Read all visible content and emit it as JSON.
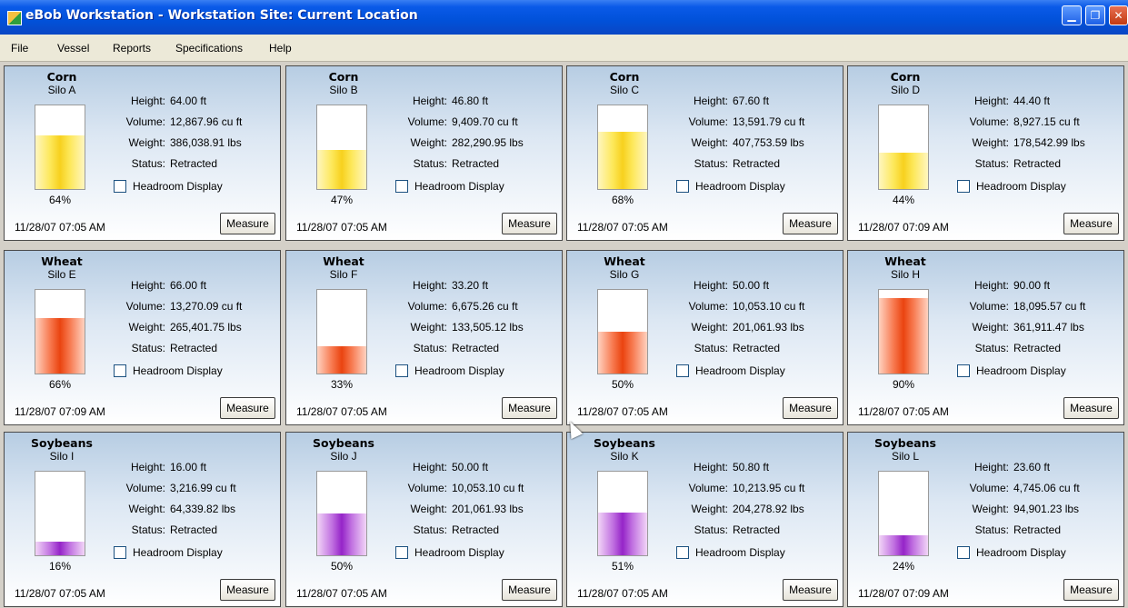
{
  "window": {
    "title": "eBob Workstation - Workstation Site: Current Location",
    "icons": [
      "app-icon",
      "minimize-icon",
      "restore-icon",
      "close-icon"
    ]
  },
  "menu": [
    "File",
    "Vessel",
    "Reports",
    "Specifications",
    "Help"
  ],
  "labels": {
    "height": "Height:",
    "volume": "Volume:",
    "weight": "Weight:",
    "status": "Status:",
    "headroom": "Headroom Display",
    "measure": "Measure"
  },
  "colors": {
    "corn": "#f7d11e",
    "wheat": "#ea4410",
    "soybeans": "#9524c8"
  },
  "silos": [
    {
      "crop": "Corn",
      "silo": "Silo A",
      "height": "64.00 ft",
      "volume": "12,867.96 cu ft",
      "weight": "386,038.91 lbs",
      "status": "Retracted",
      "percent": "64%",
      "fill": 0.64,
      "color": "yellow",
      "timestamp": "11/28/07 07:05 AM"
    },
    {
      "crop": "Corn",
      "silo": "Silo B",
      "height": "46.80 ft",
      "volume": "9,409.70 cu ft",
      "weight": "282,290.95 lbs",
      "status": "Retracted",
      "percent": "47%",
      "fill": 0.47,
      "color": "yellow",
      "timestamp": "11/28/07 07:05 AM"
    },
    {
      "crop": "Corn",
      "silo": "Silo C",
      "height": "67.60 ft",
      "volume": "13,591.79 cu ft",
      "weight": "407,753.59 lbs",
      "status": "Retracted",
      "percent": "68%",
      "fill": 0.68,
      "color": "yellow",
      "timestamp": "11/28/07 07:05 AM"
    },
    {
      "crop": "Corn",
      "silo": "Silo D",
      "height": "44.40 ft",
      "volume": "8,927.15 cu ft",
      "weight": "178,542.99 lbs",
      "status": "Retracted",
      "percent": "44%",
      "fill": 0.44,
      "color": "yellow",
      "timestamp": "11/28/07 07:09 AM"
    },
    {
      "crop": "Wheat",
      "silo": "Silo E",
      "height": "66.00 ft",
      "volume": "13,270.09 cu ft",
      "weight": "265,401.75 lbs",
      "status": "Retracted",
      "percent": "66%",
      "fill": 0.66,
      "color": "red",
      "timestamp": "11/28/07 07:09 AM"
    },
    {
      "crop": "Wheat",
      "silo": "Silo F",
      "height": "33.20 ft",
      "volume": "6,675.26 cu ft",
      "weight": "133,505.12 lbs",
      "status": "Retracted",
      "percent": "33%",
      "fill": 0.33,
      "color": "red",
      "timestamp": "11/28/07 07:05 AM"
    },
    {
      "crop": "Wheat",
      "silo": "Silo G",
      "height": "50.00 ft",
      "volume": "10,053.10 cu ft",
      "weight": "201,061.93 lbs",
      "status": "Retracted",
      "percent": "50%",
      "fill": 0.5,
      "color": "red",
      "timestamp": "11/28/07 07:05 AM"
    },
    {
      "crop": "Wheat",
      "silo": "Silo H",
      "height": "90.00 ft",
      "volume": "18,095.57 cu ft",
      "weight": "361,911.47 lbs",
      "status": "Retracted",
      "percent": "90%",
      "fill": 0.9,
      "color": "red",
      "timestamp": "11/28/07 07:05 AM"
    },
    {
      "crop": "Soybeans",
      "silo": "Silo I",
      "height": "16.00 ft",
      "volume": "3,216.99 cu ft",
      "weight": "64,339.82 lbs",
      "status": "Retracted",
      "percent": "16%",
      "fill": 0.16,
      "color": "purple",
      "timestamp": "11/28/07 07:05 AM"
    },
    {
      "crop": "Soybeans",
      "silo": "Silo J",
      "height": "50.00 ft",
      "volume": "10,053.10 cu ft",
      "weight": "201,061.93 lbs",
      "status": "Retracted",
      "percent": "50%",
      "fill": 0.5,
      "color": "purple",
      "timestamp": "11/28/07 07:05 AM"
    },
    {
      "crop": "Soybeans",
      "silo": "Silo K",
      "height": "50.80 ft",
      "volume": "10,213.95 cu ft",
      "weight": "204,278.92 lbs",
      "status": "Retracted",
      "percent": "51%",
      "fill": 0.51,
      "color": "purple",
      "timestamp": "11/28/07 07:05 AM"
    },
    {
      "crop": "Soybeans",
      "silo": "Silo L",
      "height": "23.60 ft",
      "volume": "4,745.06 cu ft",
      "weight": "94,901.23 lbs",
      "status": "Retracted",
      "percent": "24%",
      "fill": 0.24,
      "color": "purple",
      "timestamp": "11/28/07 07:09 AM"
    }
  ]
}
